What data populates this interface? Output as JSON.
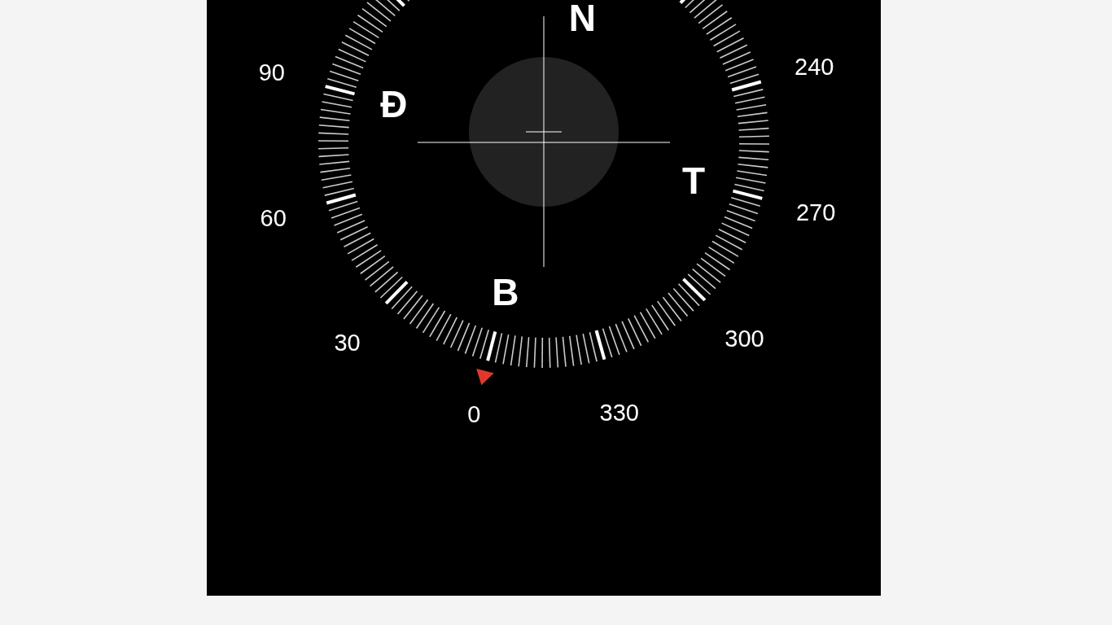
{
  "compass": {
    "cardinal_points": [
      "N",
      "Đ",
      "T",
      "B"
    ],
    "degree_labels": [
      "90",
      "240",
      "60",
      "270",
      "30",
      "300",
      "0",
      "330"
    ]
  }
}
